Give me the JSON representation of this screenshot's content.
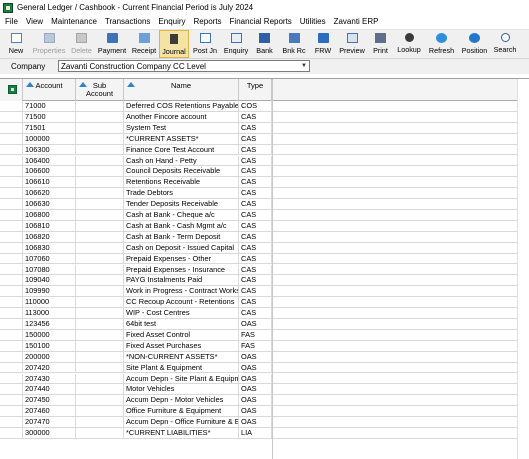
{
  "window": {
    "title": "General Ledger / Cashbook - Current Financial Period is July 2024"
  },
  "menu": [
    "File",
    "View",
    "Maintenance",
    "Transactions",
    "Enquiry",
    "Reports",
    "Financial Reports",
    "Utilities",
    "Zavanti ERP"
  ],
  "toolbar": [
    {
      "label": "New",
      "icon": "new-document-icon",
      "disabled": false,
      "active": false
    },
    {
      "label": "Properties",
      "icon": "properties-icon",
      "disabled": true,
      "active": false
    },
    {
      "label": "Delete",
      "icon": "delete-icon",
      "disabled": true,
      "active": false
    },
    {
      "label": "Payment",
      "icon": "payment-icon",
      "disabled": false,
      "active": false
    },
    {
      "label": "Receipt",
      "icon": "receipt-icon",
      "disabled": false,
      "active": false
    },
    {
      "label": "Journal",
      "icon": "journal-icon",
      "disabled": false,
      "active": true
    },
    {
      "label": "Post Jn",
      "icon": "post-journal-icon",
      "disabled": false,
      "active": false
    },
    {
      "label": "Enquiry",
      "icon": "enquiry-icon",
      "disabled": false,
      "active": false
    },
    {
      "label": "Bank",
      "icon": "bank-icon",
      "disabled": false,
      "active": false
    },
    {
      "label": "Bnk Rc",
      "icon": "bank-reconcile-icon",
      "disabled": false,
      "active": false
    },
    {
      "label": "FRW",
      "icon": "frw-icon",
      "disabled": false,
      "active": false
    },
    {
      "label": "Preview",
      "icon": "preview-icon",
      "disabled": false,
      "active": false
    },
    {
      "label": "Print",
      "icon": "print-icon",
      "disabled": false,
      "active": false
    },
    {
      "label": "Lookup",
      "icon": "lookup-icon",
      "disabled": false,
      "active": false
    },
    {
      "label": "Refresh",
      "icon": "refresh-icon",
      "disabled": false,
      "active": false
    },
    {
      "label": "Position",
      "icon": "position-icon",
      "disabled": false,
      "active": false
    },
    {
      "label": "Search",
      "icon": "search-icon",
      "disabled": false,
      "active": false
    }
  ],
  "company": {
    "label": "Company",
    "value": "Zavanti Construction Company CC Level"
  },
  "grid": {
    "columns": {
      "account": "Account",
      "sub_account_1": "Sub",
      "sub_account_2": "Account",
      "name": "Name",
      "type": "Type"
    },
    "rows": [
      {
        "account": "71000",
        "sub": "",
        "name": "Deferred COS Retentions Payable",
        "type": "COS"
      },
      {
        "account": "71500",
        "sub": "",
        "name": "Another Fincore account",
        "type": "CAS"
      },
      {
        "account": "71501",
        "sub": "",
        "name": "System Test",
        "type": "CAS"
      },
      {
        "account": "100000",
        "sub": "",
        "name": "*CURRENT ASSETS*",
        "type": "CAS"
      },
      {
        "account": "106300",
        "sub": "",
        "name": "Finance Core Test Account",
        "type": "CAS"
      },
      {
        "account": "106400",
        "sub": "",
        "name": "Cash on Hand - Petty",
        "type": "CAS"
      },
      {
        "account": "106600",
        "sub": "",
        "name": "Council Deposits Receivable",
        "type": "CAS"
      },
      {
        "account": "106610",
        "sub": "",
        "name": "Retentions Receivable",
        "type": "CAS"
      },
      {
        "account": "106620",
        "sub": "",
        "name": "Trade Debtors",
        "type": "CAS"
      },
      {
        "account": "106630",
        "sub": "",
        "name": "Tender Deposits Receivable",
        "type": "CAS"
      },
      {
        "account": "106800",
        "sub": "",
        "name": "Cash at Bank - Cheque a/c",
        "type": "CAS"
      },
      {
        "account": "106810",
        "sub": "",
        "name": "Cash at Bank - Cash Mgmt a/c",
        "type": "CAS"
      },
      {
        "account": "106820",
        "sub": "",
        "name": "Cash at Bank - Term Deposit",
        "type": "CAS"
      },
      {
        "account": "106830",
        "sub": "",
        "name": "Cash on Deposit - Issued Capital",
        "type": "CAS"
      },
      {
        "account": "107060",
        "sub": "",
        "name": "Prepaid Expenses - Other",
        "type": "CAS"
      },
      {
        "account": "107080",
        "sub": "",
        "name": "Prepaid Expenses - Insurance",
        "type": "CAS"
      },
      {
        "account": "109040",
        "sub": "",
        "name": "PAYG Instalments Paid",
        "type": "CAS"
      },
      {
        "account": "109990",
        "sub": "",
        "name": "Work in Progress - Contract Works",
        "type": "CAS"
      },
      {
        "account": "110000",
        "sub": "",
        "name": "CC Recoup Account - Retentions",
        "type": "CAS"
      },
      {
        "account": "113000",
        "sub": "",
        "name": "WIP - Cost Centres",
        "type": "CAS"
      },
      {
        "account": "123456",
        "sub": "",
        "name": "64bit test",
        "type": "OAS"
      },
      {
        "account": "150000",
        "sub": "",
        "name": "Fixed Asset Control",
        "type": "FAS"
      },
      {
        "account": "150100",
        "sub": "",
        "name": "Fixed Asset Purchases",
        "type": "FAS"
      },
      {
        "account": "200000",
        "sub": "",
        "name": "*NON-CURRENT ASSETS*",
        "type": "OAS"
      },
      {
        "account": "207420",
        "sub": "",
        "name": "Site Plant & Equipment",
        "type": "OAS"
      },
      {
        "account": "207430",
        "sub": "",
        "name": "Accum Depn - Site Plant & Equipmen",
        "type": "OAS"
      },
      {
        "account": "207440",
        "sub": "",
        "name": "Motor Vehicles",
        "type": "OAS"
      },
      {
        "account": "207450",
        "sub": "",
        "name": "Accum Depn - Motor Vehicles",
        "type": "OAS"
      },
      {
        "account": "207460",
        "sub": "",
        "name": "Office Furniture & Equipment",
        "type": "OAS"
      },
      {
        "account": "207470",
        "sub": "",
        "name": "Accum Depn - Office Furniture & Equ",
        "type": "OAS"
      },
      {
        "account": "300000",
        "sub": "",
        "name": "*CURRENT LIABILITIES*",
        "type": "LIA"
      }
    ]
  }
}
